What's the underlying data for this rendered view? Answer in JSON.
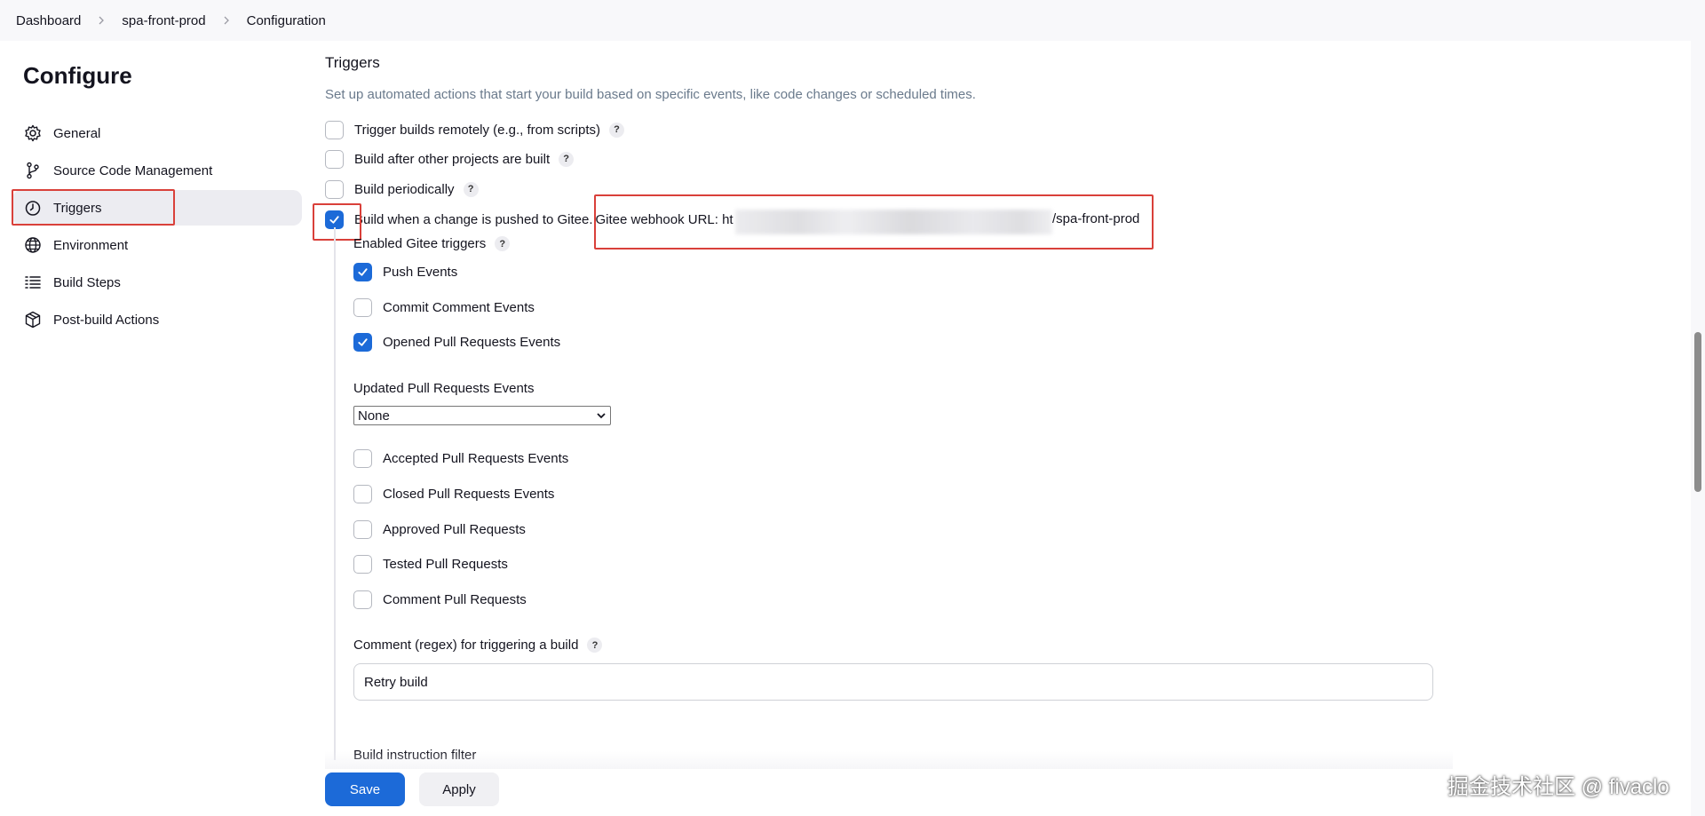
{
  "breadcrumb": {
    "items": [
      "Dashboard",
      "spa-front-prod",
      "Configuration"
    ]
  },
  "sidebar": {
    "title": "Configure",
    "items": [
      {
        "label": "General",
        "icon": "gear-icon"
      },
      {
        "label": "Source Code Management",
        "icon": "branch-icon"
      },
      {
        "label": "Triggers",
        "icon": "timer-icon",
        "active": true
      },
      {
        "label": "Environment",
        "icon": "globe-icon"
      },
      {
        "label": "Build Steps",
        "icon": "list-icon"
      },
      {
        "label": "Post-build Actions",
        "icon": "package-icon"
      }
    ]
  },
  "triggers": {
    "title": "Triggers",
    "description": "Set up automated actions that start your build based on specific events, like code changes or scheduled times.",
    "options": [
      {
        "label": "Trigger builds remotely (e.g., from scripts)",
        "checked": false
      },
      {
        "label": "Build after other projects are built",
        "checked": false
      },
      {
        "label": "Build periodically",
        "checked": false
      },
      {
        "label": "Build when a change is pushed to Gitee.",
        "checked": true
      }
    ],
    "webhook_label": "Gitee webhook URL: ht",
    "webhook_suffix": "/spa-front-prod",
    "help_mark": "?"
  },
  "gitee": {
    "enabled_label": "Enabled Gitee triggers",
    "events_top": [
      {
        "label": "Push Events",
        "checked": true
      },
      {
        "label": "Commit Comment Events",
        "checked": false
      },
      {
        "label": "Opened Pull Requests Events",
        "checked": true
      }
    ],
    "updated_label": "Updated Pull Requests Events",
    "updated_selected": "None",
    "events_bottom": [
      {
        "label": "Accepted Pull Requests Events",
        "checked": false
      },
      {
        "label": "Closed Pull Requests Events",
        "checked": false
      },
      {
        "label": "Approved Pull Requests",
        "checked": false
      },
      {
        "label": "Tested Pull Requests",
        "checked": false
      },
      {
        "label": "Comment Pull Requests",
        "checked": false
      }
    ],
    "comment_label": "Comment (regex) for triggering a build",
    "comment_value": "Retry build",
    "filter_label": "Build instruction filter"
  },
  "actions": {
    "save": "Save",
    "apply": "Apply"
  },
  "watermark": "掘金技术社区 @ fivaclo",
  "colors": {
    "accent": "#1c6ad8",
    "annotation": "#d9403a"
  }
}
